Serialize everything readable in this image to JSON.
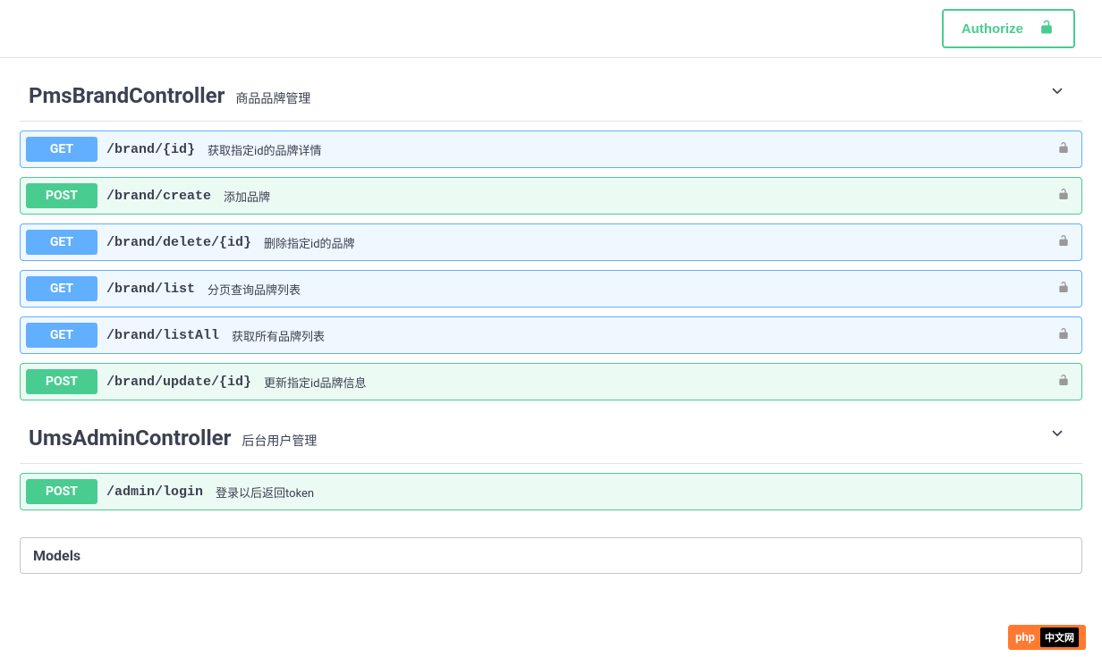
{
  "authorize_label": "Authorize",
  "controllers": [
    {
      "name": "PmsBrandController",
      "desc": "商品品牌管理",
      "ops": [
        {
          "method": "GET",
          "path": "/brand/{id}",
          "summary": "获取指定id的品牌详情",
          "auth": true
        },
        {
          "method": "POST",
          "path": "/brand/create",
          "summary": "添加品牌",
          "auth": true
        },
        {
          "method": "GET",
          "path": "/brand/delete/{id}",
          "summary": "删除指定id的品牌",
          "auth": true
        },
        {
          "method": "GET",
          "path": "/brand/list",
          "summary": "分页查询品牌列表",
          "auth": true
        },
        {
          "method": "GET",
          "path": "/brand/listAll",
          "summary": "获取所有品牌列表",
          "auth": true
        },
        {
          "method": "POST",
          "path": "/brand/update/{id}",
          "summary": "更新指定id品牌信息",
          "auth": true
        }
      ]
    },
    {
      "name": "UmsAdminController",
      "desc": "后台用户管理",
      "ops": [
        {
          "method": "POST",
          "path": "/admin/login",
          "summary": "登录以后返回token",
          "auth": false
        }
      ]
    }
  ],
  "models_label": "Models",
  "badge": {
    "text": "php",
    "tail": "中文网"
  }
}
